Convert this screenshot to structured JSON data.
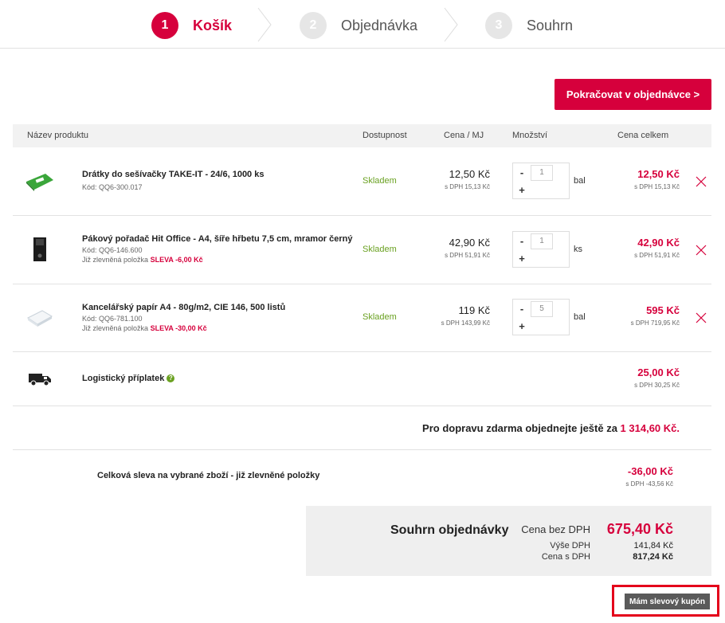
{
  "steps": [
    {
      "num": "1",
      "label": "Košík"
    },
    {
      "num": "2",
      "label": "Objednávka"
    },
    {
      "num": "3",
      "label": "Souhrn"
    }
  ],
  "continue_label": "Pokračovat v objednávce  >",
  "table_headers": {
    "name": "Název produktu",
    "availability": "Dostupnost",
    "unit_price": "Cena / MJ",
    "quantity": "Množství",
    "total": "Cena celkem"
  },
  "items": [
    {
      "name": "Drátky do sešívačky TAKE-IT - 24/6, 1000 ks",
      "code": "Kód: QQ6-300.017",
      "note_prefix": "",
      "note_discount": "",
      "availability": "Skladem",
      "unit_price": "12,50 Kč",
      "unit_price_vat": "s DPH 15,13 Kč",
      "qty_minus": "-",
      "qty_plus": "+",
      "qty": "1",
      "uom": "bal",
      "total": "12,50 Kč",
      "total_vat": "s DPH 15,13 Kč"
    },
    {
      "name": "Pákový pořadač Hit Office - A4, šíře hřbetu 7,5 cm, mramor černý",
      "code": "Kód: QQ6-146.600",
      "note_prefix": "Již zlevněná položka ",
      "note_discount": "SLEVA -6,00 Kč",
      "availability": "Skladem",
      "unit_price": "42,90 Kč",
      "unit_price_vat": "s DPH 51,91 Kč",
      "qty_minus": "-",
      "qty_plus": "+",
      "qty": "1",
      "uom": "ks",
      "total": "42,90 Kč",
      "total_vat": "s DPH 51,91 Kč"
    },
    {
      "name": "Kancelářský papír A4 - 80g/m2, CIE 146, 500 listů",
      "code": "Kód: QQ6-781.100",
      "note_prefix": "Již zlevněná položka ",
      "note_discount": "SLEVA -30,00 Kč",
      "availability": "Skladem",
      "unit_price": "119 Kč",
      "unit_price_vat": "s DPH 143,99 Kč",
      "qty_minus": "-",
      "qty_plus": "+",
      "qty": "5",
      "uom": "bal",
      "total": "595 Kč",
      "total_vat": "s DPH 719,95 Kč"
    }
  ],
  "logistic": {
    "name": "Logistický příplatek",
    "help": "?",
    "total": "25,00 Kč",
    "total_vat": "s DPH 30,25 Kč"
  },
  "free_shipping": {
    "prefix": "Pro dopravu zdarma objednejte ještě za ",
    "amount": "1 314,60 Kč."
  },
  "discount": {
    "label": "Celková sleva na vybrané zboží - již zlevněné položky",
    "value": "-36,00 Kč",
    "vat": "s DPH -43,56 Kč"
  },
  "summary": {
    "title": "Souhrn objednávky",
    "price_excl_label": "Cena bez DPH",
    "price_excl": "675,40 Kč",
    "vat_label": "Výše DPH",
    "vat": "141,84 Kč",
    "price_incl_label": "Cena s DPH",
    "price_incl": "817,24 Kč"
  },
  "coupon_label": "Mám slevový kupón",
  "colors": {
    "accent": "#d6003c",
    "available": "#6aa121",
    "highlight_frame": "#e4001b"
  }
}
